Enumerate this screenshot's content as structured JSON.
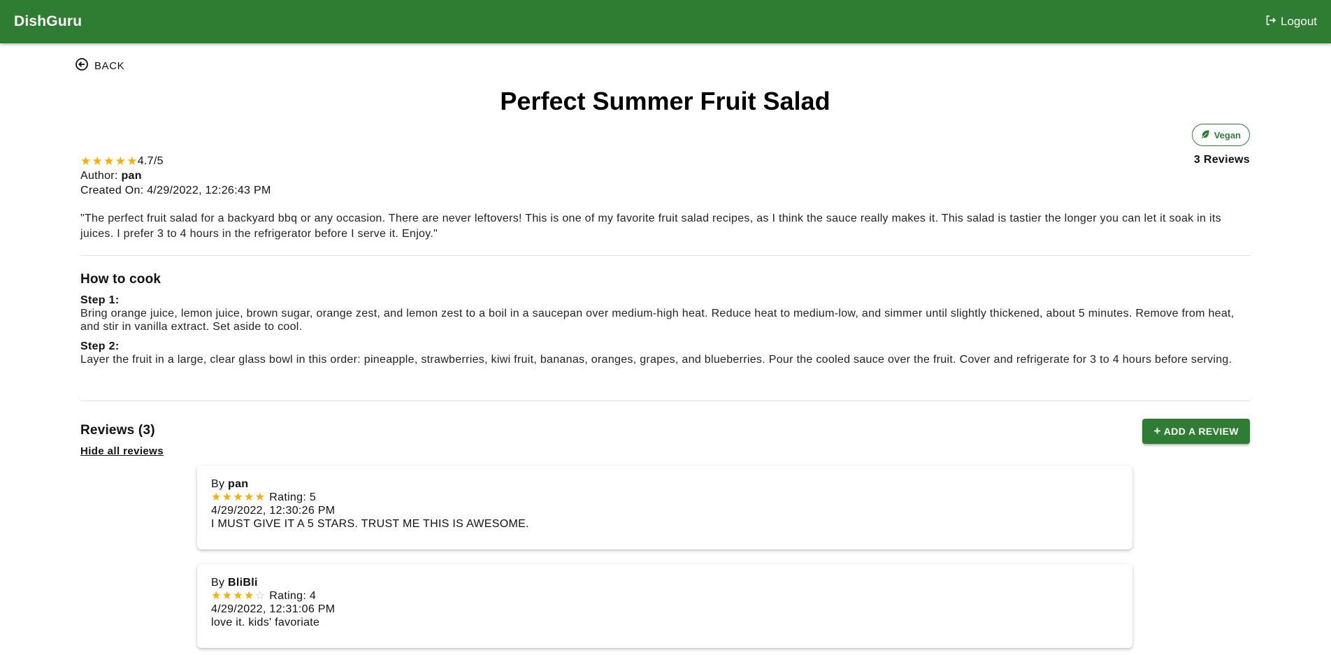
{
  "header": {
    "brand": "DishGuru",
    "logout_label": "Logout"
  },
  "nav": {
    "back_label": "BACK"
  },
  "recipe": {
    "title": "Perfect Summer Fruit Salad",
    "tag": "Vegan",
    "review_count_label": "3 Reviews",
    "rating": 4.7,
    "rating_label": "4.7/5",
    "author_prefix": "Author: ",
    "author": "pan",
    "created_label": "Created On: 4/29/2022, 12:26:43 PM",
    "description": "\"The perfect fruit salad for a backyard bbq or any occasion. There are never leftovers! This is one of my favorite fruit salad recipes, as I think the sauce really makes it. This salad is tastier the longer you can let it soak in its juices. I prefer 3 to 4 hours in the refrigerator before I serve it. Enjoy.\""
  },
  "how_to_cook": {
    "title": "How to cook",
    "steps": [
      {
        "label": "Step 1:",
        "text": "Bring orange juice, lemon juice, brown sugar, orange zest, and lemon zest to a boil in a saucepan over medium-high heat. Reduce heat to medium-low, and simmer until slightly thickened, about 5 minutes. Remove from heat, and stir in vanilla extract. Set aside to cool."
      },
      {
        "label": "Step 2:",
        "text": "Layer the fruit in a large, clear glass bowl in this order: pineapple, strawberries, kiwi fruit, bananas, oranges, grapes, and blueberries. Pour the cooled sauce over the fruit. Cover and refrigerate for 3 to 4 hours before serving."
      }
    ]
  },
  "reviews": {
    "title": "Reviews (3)",
    "add_label": "ADD A REVIEW",
    "hide_label": "Hide all reviews",
    "items": [
      {
        "by_prefix": "By ",
        "user": "pan",
        "rating": 5,
        "rating_label": "Rating: 5",
        "date": "4/29/2022, 12:30:26 PM",
        "comment": "I MUST GIVE IT A 5 STARS. TRUST ME THIS IS AWESOME."
      },
      {
        "by_prefix": "By ",
        "user": "BliBli",
        "rating": 4,
        "rating_label": "Rating: 4",
        "date": "4/29/2022, 12:31:06 PM",
        "comment": "love it. kids' favoriate"
      }
    ]
  },
  "colors": {
    "primary": "#2e7d32",
    "star": "#faaf00",
    "star_empty": "#bdbdbd"
  },
  "icons": {
    "logout": "logout-icon",
    "back": "arrow-circle-left-icon",
    "vegan": "leaf-icon",
    "add": "plus-icon",
    "star": "star-icon"
  }
}
